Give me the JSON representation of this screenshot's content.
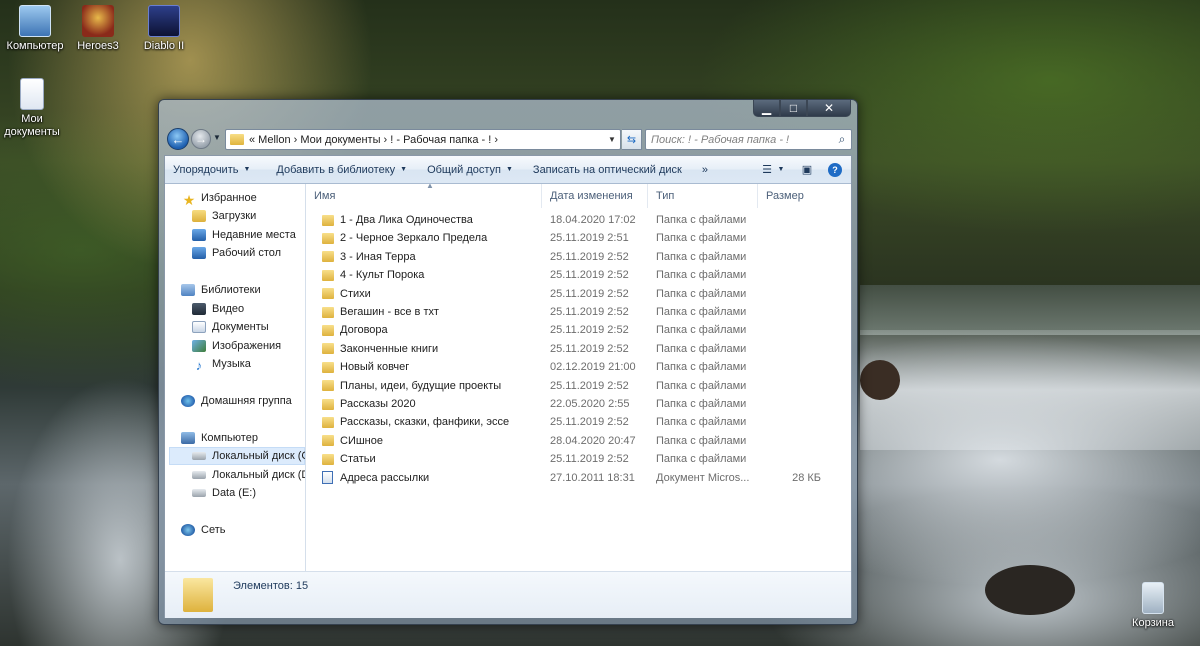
{
  "desktop": {
    "icons": [
      {
        "label": "Компьютер",
        "icon": "computer-icon"
      },
      {
        "label": "Heroes3",
        "icon": "heroes3-icon"
      },
      {
        "label": "Diablo II",
        "icon": "diablo2-icon"
      },
      {
        "label": "Мои документы",
        "icon": "documents-icon"
      },
      {
        "label": "Корзина",
        "icon": "recycle-bin-icon"
      }
    ]
  },
  "window": {
    "controls": {
      "minimize": "▁",
      "maximize": "□",
      "close": "✕"
    },
    "nav": {
      "back": "←",
      "forward": "→",
      "drop": "▼"
    },
    "address": {
      "path": "«  Mellon  ›  Мои документы  ›  ! - Рабочая папка - !  ›",
      "drop": "▼",
      "refresh": "⇆"
    },
    "search": {
      "placeholder": "Поиск: ! - Рабочая папка - !",
      "icon": "⌕"
    },
    "toolbar": {
      "organize": "Упорядочить",
      "add_to_library": "Добавить в библиотеку",
      "share": "Общий доступ",
      "burn": "Записать на оптический диск",
      "more": "»",
      "views_icon": "☰",
      "views_drop": "▼",
      "preview_icon": "▣",
      "help_icon": "?"
    },
    "sidebar": {
      "favorites": "Избранное",
      "downloads": "Загрузки",
      "recent": "Недавние места",
      "desktop": "Рабочий стол",
      "libraries": "Библиотеки",
      "video": "Видео",
      "documents": "Документы",
      "images": "Изображения",
      "music": "Музыка",
      "homegroup": "Домашняя группа",
      "computer": "Компьютер",
      "local_c": "Локальный диск (C",
      "local_d": "Локальный диск (D",
      "data_e": "Data (E:)",
      "network": "Сеть"
    },
    "columns": {
      "name": "Имя",
      "date": "Дата изменения",
      "type": "Тип",
      "size": "Размер"
    },
    "files": [
      {
        "name": "1 - Два Лика Одиночества",
        "date": "18.04.2020 17:02",
        "type": "Папка с файлами",
        "size": "",
        "kind": "folder"
      },
      {
        "name": "2 - Черное Зеркало Предела",
        "date": "25.11.2019 2:51",
        "type": "Папка с файлами",
        "size": "",
        "kind": "folder"
      },
      {
        "name": "3 - Иная Терра",
        "date": "25.11.2019 2:52",
        "type": "Папка с файлами",
        "size": "",
        "kind": "folder"
      },
      {
        "name": "4 - Культ Порока",
        "date": "25.11.2019 2:52",
        "type": "Папка с файлами",
        "size": "",
        "kind": "folder"
      },
      {
        "name": "Стихи",
        "date": "25.11.2019 2:52",
        "type": "Папка с файлами",
        "size": "",
        "kind": "folder"
      },
      {
        "name": "Вегашин - все в тхт",
        "date": "25.11.2019 2:52",
        "type": "Папка с файлами",
        "size": "",
        "kind": "folder"
      },
      {
        "name": "Договора",
        "date": "25.11.2019 2:52",
        "type": "Папка с файлами",
        "size": "",
        "kind": "folder"
      },
      {
        "name": "Законченные книги",
        "date": "25.11.2019 2:52",
        "type": "Папка с файлами",
        "size": "",
        "kind": "folder"
      },
      {
        "name": "Новый ковчег",
        "date": "02.12.2019 21:00",
        "type": "Папка с файлами",
        "size": "",
        "kind": "folder"
      },
      {
        "name": "Планы, идеи, будущие проекты",
        "date": "25.11.2019 2:52",
        "type": "Папка с файлами",
        "size": "",
        "kind": "folder"
      },
      {
        "name": "Рассказы 2020",
        "date": "22.05.2020 2:55",
        "type": "Папка с файлами",
        "size": "",
        "kind": "folder"
      },
      {
        "name": "Рассказы, сказки, фанфики, эссе",
        "date": "25.11.2019 2:52",
        "type": "Папка с файлами",
        "size": "",
        "kind": "folder"
      },
      {
        "name": "СИшное",
        "date": "28.04.2020 20:47",
        "type": "Папка с файлами",
        "size": "",
        "kind": "folder"
      },
      {
        "name": "Статьи",
        "date": "25.11.2019 2:52",
        "type": "Папка с файлами",
        "size": "",
        "kind": "folder"
      },
      {
        "name": "Адреса рассылки",
        "date": "27.10.2011 18:31",
        "type": "Документ Micros...",
        "size": "28 КБ",
        "kind": "document"
      }
    ],
    "status": {
      "item_count": "Элементов: 15"
    }
  }
}
